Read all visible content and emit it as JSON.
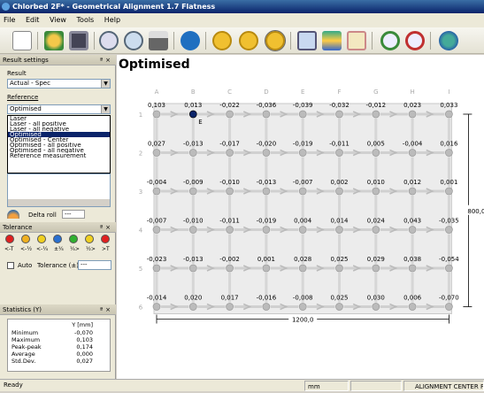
{
  "window": {
    "title": "Chlorbed 2F* - Geometrical Alignment 1.7 Flatness"
  },
  "menu": [
    "File",
    "Edit",
    "View",
    "Tools",
    "Help"
  ],
  "toolbar": {
    "icons": [
      "new-icon",
      "open-icon",
      "save-icon",
      "zoom-icon",
      "preview-icon",
      "print-icon",
      "info-icon",
      "dim-icon",
      "m-icon",
      "res-icon",
      "ruler-icon",
      "layers-icon",
      "table-icon",
      "zoom-in-icon",
      "zoom-out-icon",
      "globe-icon"
    ]
  },
  "result_settings": {
    "header": "Result settings",
    "result_label": "Result",
    "result_value": "Actual - Spec",
    "reference_label": "Reference",
    "reference_value": "Optimised",
    "reference_options": [
      "Laser",
      "Laser - all positive",
      "Laser - all negative",
      "Optimised",
      "Optimised - Center",
      "Optimised - all positive",
      "Optimised - all negative",
      "Reference measurement"
    ],
    "delta_roll_label": "Delta roll",
    "delta_roll_value": "---"
  },
  "tolerance": {
    "header": "Tolerance",
    "labels": [
      "<-T",
      "<-½",
      "<-¼",
      "±¼",
      "¼>",
      "½>",
      ">T"
    ],
    "colors": [
      "#e02020",
      "#f0b020",
      "#f0d020",
      "#2a70d0",
      "#30b030",
      "#f0d020",
      "#e02020"
    ],
    "auto_label": "Auto",
    "tol_label": "Tolerance (±)",
    "tol_value": "---"
  },
  "statistics": {
    "header": "Statistics (Y)",
    "col_header": "Y [mm]",
    "rows": [
      {
        "label": "Minimum",
        "value": "-0,070"
      },
      {
        "label": "Maximum",
        "value": "0,103"
      },
      {
        "label": "Peak-peak",
        "value": "0,174"
      },
      {
        "label": "Average",
        "value": "0,000"
      },
      {
        "label": "Std.Dev.",
        "value": "0,027"
      }
    ]
  },
  "main": {
    "title": "Optimised",
    "col_letters": [
      "A",
      "B",
      "C",
      "D",
      "E",
      "F",
      "G",
      "H",
      "I"
    ],
    "row_numbers": [
      "1",
      "2",
      "3",
      "4",
      "5",
      "6"
    ],
    "values": [
      [
        "0,103",
        "0,013",
        "-0,022",
        "-0,036",
        "-0,039",
        "-0,032",
        "-0,012",
        "0,023",
        "0,033"
      ],
      [
        "0,027",
        "-0,013",
        "-0,017",
        "-0,020",
        "-0,019",
        "-0,011",
        "0,005",
        "-0,004",
        "0,016"
      ],
      [
        "-0,004",
        "-0,009",
        "-0,010",
        "-0,013",
        "-0,007",
        "0,002",
        "0,010",
        "0,012",
        "0,001"
      ],
      [
        "-0,007",
        "-0,010",
        "-0,011",
        "-0,019",
        "0,004",
        "0,014",
        "0,024",
        "0,043",
        "-0,035"
      ],
      [
        "-0,023",
        "-0,013",
        "-0,002",
        "0,001",
        "0,028",
        "0,025",
        "0,029",
        "0,038",
        "-0,054"
      ],
      [
        "-0,014",
        "0,020",
        "0,017",
        "-0,016",
        "-0,008",
        "0,025",
        "0,030",
        "0,006",
        "-0,070"
      ]
    ],
    "marker_label": "E",
    "width_dim": "1200,0",
    "height_dim": "800,0"
  },
  "status": {
    "ready": "Ready",
    "unit": "mm",
    "mode": "ALIGNMENT CENTER Fla"
  }
}
